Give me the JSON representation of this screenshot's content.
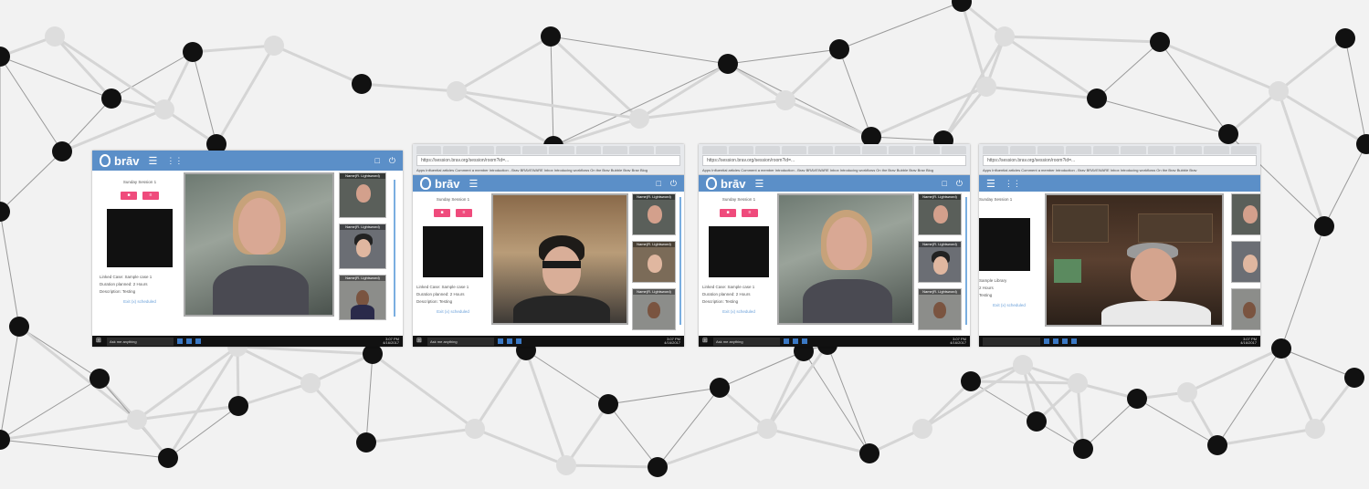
{
  "screenshots": [
    {
      "id": "shot-1",
      "has_browser_chrome": false,
      "logo_text": "brāv",
      "session_title": "Sunday Session 1",
      "pink_buttons": [
        "■",
        "≡"
      ],
      "meta": [
        "Linked Case: Sample case 1",
        "Duration planned: 2 Hours",
        "Description: Testing"
      ],
      "leave_link": "Exit (x) scheduled",
      "thumbnail_names": [
        "Name(R. Lightsword)",
        "Name(R. Lightsword)",
        "Name(R. Lightsword)"
      ],
      "taskbar_search": "Ask me anything",
      "clock": [
        "3:07 PM",
        "4/16/2017"
      ]
    },
    {
      "id": "shot-2",
      "has_browser_chrome": true,
      "url": "https://session.brav.org/session/room?id=...",
      "bookmarks": "Apps   Influential articles   Comment a member   Introduction - Brav   BRAVEWARE   Inbox   Introducing workflows   On the Brav Bubble   Brav   Brav Blog",
      "logo_text": "brāv",
      "session_title": "Sunday Session 1",
      "pink_buttons": [
        "■",
        "≡"
      ],
      "meta": [
        "Linked Case: Sample case 1",
        "Duration planned: 2 Hours",
        "Description: Testing"
      ],
      "leave_link": "Exit (x) scheduled",
      "thumbnail_names": [
        "Name(R. Lightsword)",
        "Name(R. Lightsword)",
        "Name(R. Lightsword)"
      ],
      "taskbar_search": "Ask me anything",
      "clock": [
        "3:07 PM",
        "4/16/2017"
      ]
    },
    {
      "id": "shot-3",
      "has_browser_chrome": true,
      "url": "https://session.brav.org/session/room?id=...",
      "bookmarks": "Apps   Influential articles   Comment a member   Introduction - Brav   BRAVEWARE   Inbox   Introducing workflows   On the Brav Bubble   Brav   Brav Blog",
      "logo_text": "brāv",
      "session_title": "Sunday Session 1",
      "pink_buttons": [
        "■",
        "≡"
      ],
      "meta": [
        "Linked Case: Sample case 1",
        "Duration planned: 2 Hours",
        "Description: Testing"
      ],
      "leave_link": "Exit (x) scheduled",
      "thumbnail_names": [
        "Name(R. Lightsword)",
        "Name(R. Lightsword)",
        "Name(R. Lightsword)"
      ],
      "taskbar_search": "Ask me anything",
      "clock": [
        "3:07 PM",
        "4/16/2017"
      ]
    },
    {
      "id": "shot-4",
      "has_browser_chrome": true,
      "url": "https://session.brav.org/session/room?id=...",
      "bookmarks": "Apps   Influential articles   Comment a member   Introduction - Brav   BRAVEWARE   Inbox   Introducing workflows   On the Brav Bubble   Brav",
      "logo_text": "",
      "session_title": "Sunday Session 1",
      "pink_buttons": [],
      "meta": [
        "Sample Library",
        "2 Hours",
        "Testing"
      ],
      "leave_link": "Exit (x) scheduled",
      "thumbnail_names": [],
      "taskbar_search": "",
      "clock": [
        "3:07 PM",
        "4/16/2017"
      ]
    }
  ],
  "colors": {
    "appbar": "#5b8fc8",
    "pink": "#ef4b7c",
    "background": "#f2f2f2",
    "node": "#111111",
    "link_line": "#9a9a9a"
  }
}
